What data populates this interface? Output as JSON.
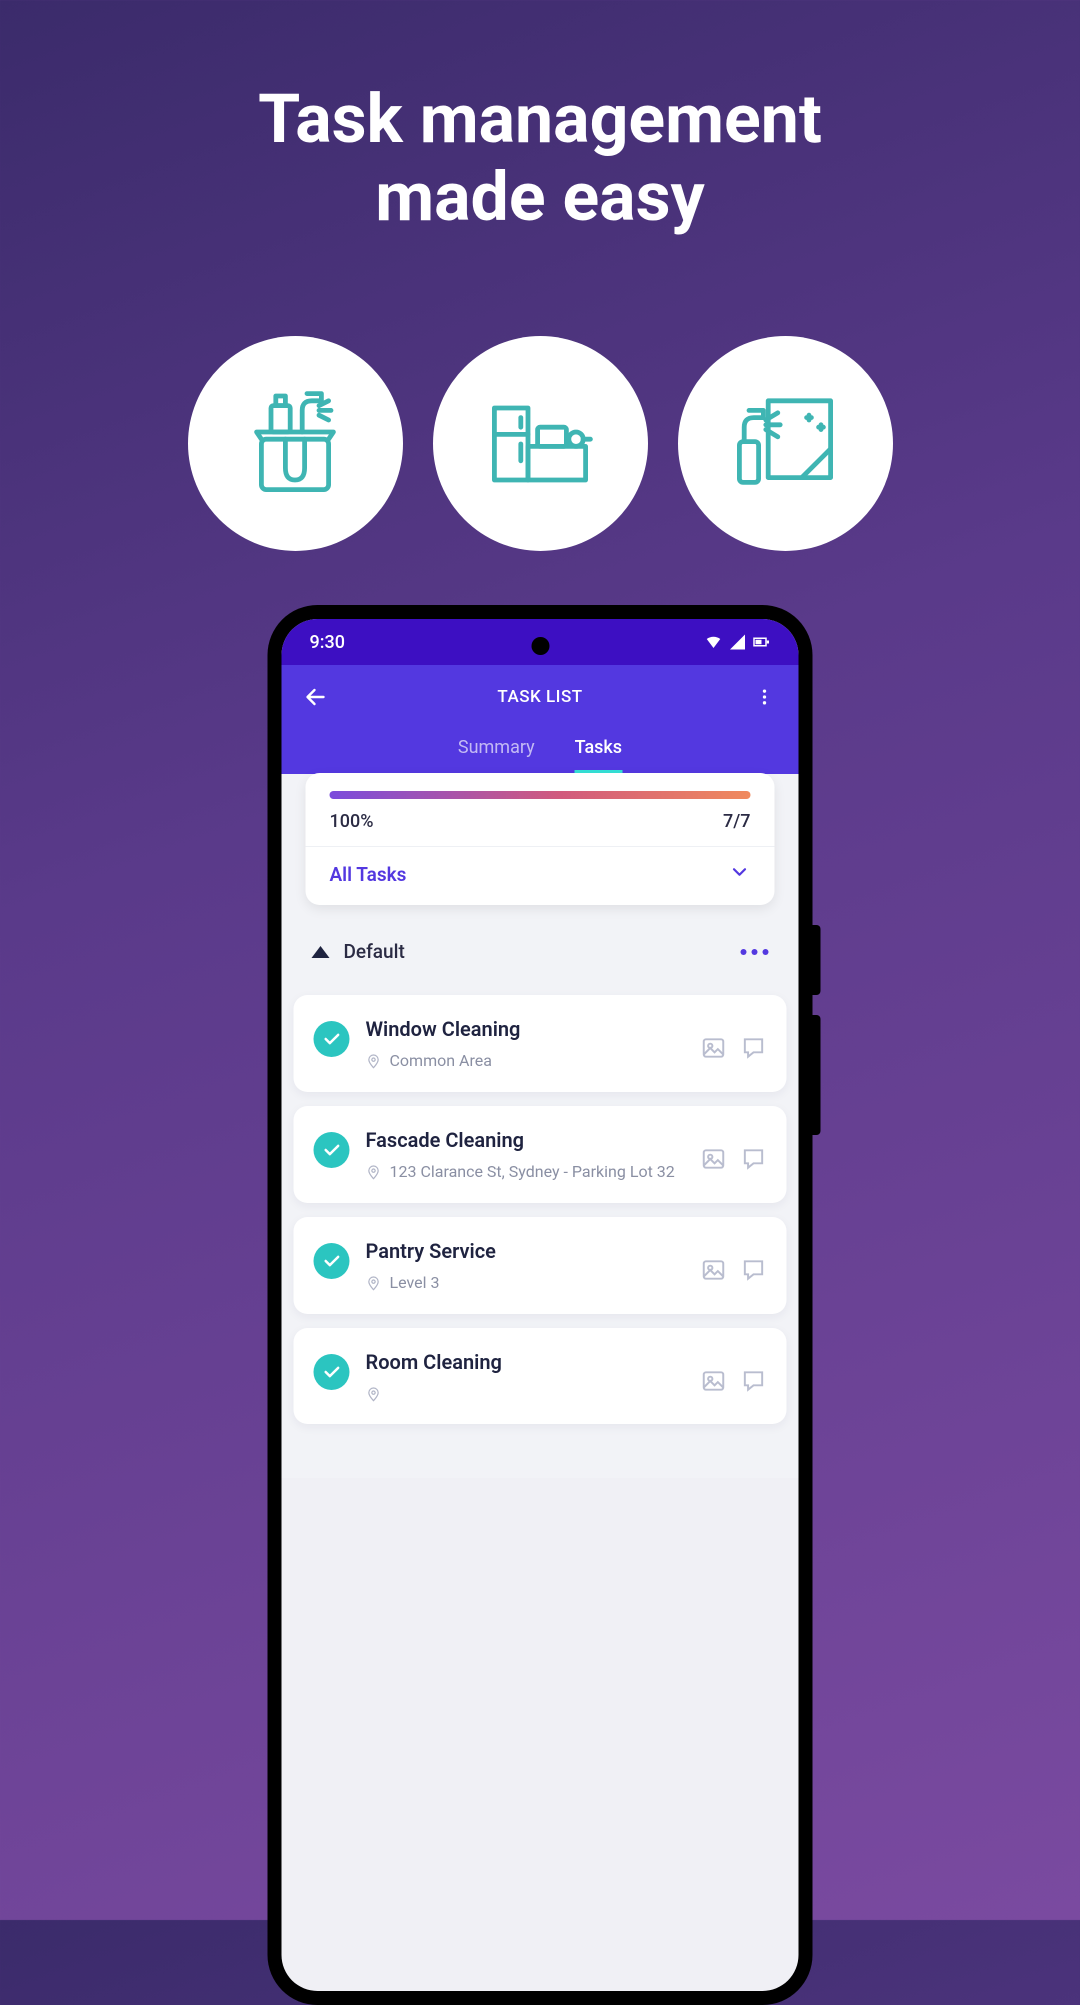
{
  "promo": {
    "title_line1": "Task management",
    "title_line2": "made easy"
  },
  "phone": {
    "status": {
      "time": "9:30"
    },
    "header": {
      "title": "TASK LIST",
      "tabs": {
        "summary": "Summary",
        "tasks": "Tasks"
      }
    },
    "progress": {
      "percent": "100%",
      "count": "7/7"
    },
    "filter": {
      "label": "All Tasks"
    },
    "section": {
      "title": "Default"
    },
    "tasks": [
      {
        "title": "Window Cleaning",
        "location": "Common Area"
      },
      {
        "title": "Fascade Cleaning",
        "location": "123 Clarance St, Sydney - Parking Lot 32"
      },
      {
        "title": "Pantry Service",
        "location": "Level 3"
      },
      {
        "title": "Room Cleaning",
        "location": ""
      }
    ]
  }
}
